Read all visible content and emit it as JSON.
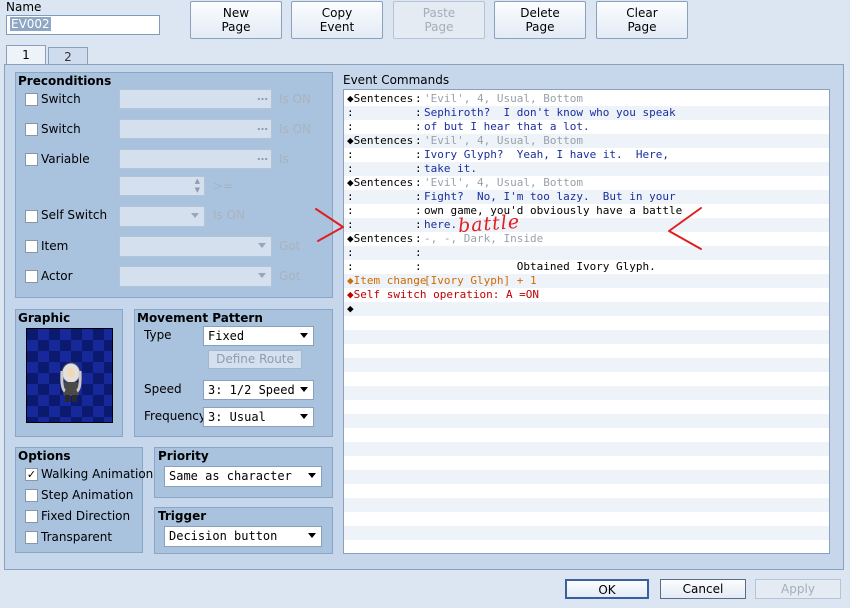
{
  "name_field": {
    "label": "Name",
    "value": "EV002"
  },
  "toolbar": {
    "new_page": [
      "New",
      "Page"
    ],
    "copy_event": [
      "Copy",
      "Event"
    ],
    "paste_page": [
      "Paste",
      "Page"
    ],
    "delete_page": [
      "Delete",
      "Page"
    ],
    "clear_page": [
      "Clear",
      "Page"
    ]
  },
  "tabs": [
    {
      "label": "1",
      "active": true
    },
    {
      "label": "2",
      "active": false
    }
  ],
  "preconditions": {
    "title": "Preconditions",
    "switch1": {
      "label": "Switch",
      "suffix": "Is ON"
    },
    "switch2": {
      "label": "Switch",
      "suffix": "Is ON"
    },
    "variable": {
      "label": "Variable",
      "suffix": "Is",
      "compare": ">="
    },
    "self_switch": {
      "label": "Self Switch",
      "suffix": "Is ON"
    },
    "item": {
      "label": "Item",
      "suffix": "Got"
    },
    "actor": {
      "label": "Actor",
      "suffix": "Got"
    }
  },
  "graphic": {
    "title": "Graphic"
  },
  "movement": {
    "title": "Movement Pattern",
    "type_label": "Type",
    "type_value": "Fixed",
    "define_route": "Define Route",
    "speed_label": "Speed",
    "speed_value": "3: 1/2 Speed",
    "frequency_label": "Frequency",
    "frequency_value": "3: Usual"
  },
  "options": {
    "title": "Options",
    "walking": "Walking Animation",
    "step": "Step Animation",
    "fixed": "Fixed Direction",
    "transparent": "Transparent"
  },
  "priority": {
    "title": "Priority",
    "value": "Same as character"
  },
  "trigger": {
    "title": "Trigger",
    "value": "Decision button"
  },
  "event_commands": {
    "title": "Event Commands",
    "rows": [
      {
        "c1": "◆Sentences",
        "c2": ":",
        "c3": "'Evil', 4, Usual, Bottom",
        "color": "gray"
      },
      {
        "c1": ":",
        "c2": ":",
        "c3": "Sephiroth?  I don't know who you speak",
        "color": "blue"
      },
      {
        "c1": ":",
        "c2": ":",
        "c3": "of but I hear that a lot.",
        "color": "blue"
      },
      {
        "c1": "◆Sentences",
        "c2": ":",
        "c3": "'Evil', 4, Usual, Bottom",
        "color": "gray"
      },
      {
        "c1": ":",
        "c2": ":",
        "c3": "Ivory Glyph?  Yeah, I have it.  Here,",
        "color": "blue"
      },
      {
        "c1": ":",
        "c2": ":",
        "c3": "take it.",
        "color": "blue"
      },
      {
        "c1": "◆Sentences",
        "c2": ":",
        "c3": "'Evil', 4, Usual, Bottom",
        "color": "gray"
      },
      {
        "c1": ":",
        "c2": ":",
        "c3": "Fight?  No, I'm too lazy.  But in your",
        "color": "blue"
      },
      {
        "c1": ":",
        "c2": ":",
        "c3": "own game, you'd obviously have a battle",
        "color": "black"
      },
      {
        "c1": ":",
        "c2": ":",
        "c3": "here.",
        "color": "blue"
      },
      {
        "c1": "◆Sentences",
        "c2": ":",
        "c3": "-, -, Dark, Inside",
        "color": "gray"
      },
      {
        "c1": ":",
        "c2": ":",
        "c3": "",
        "color": "black"
      },
      {
        "c1": ":",
        "c2": ":",
        "c3": "              Obtained Ivory Glyph.",
        "color": "black"
      },
      {
        "c1": "◆Item change",
        "c2": ":",
        "c3": "[Ivory Glyph] + 1",
        "color": "orange"
      },
      {
        "c1": "◆Self switch operation: A =ON",
        "c2": "",
        "c3": "",
        "color": "red"
      },
      {
        "c1": "◆",
        "c2": "",
        "c3": "",
        "color": "black"
      }
    ],
    "annotation": "battle"
  },
  "dialog_buttons": {
    "ok": "OK",
    "cancel": "Cancel",
    "apply": "Apply"
  }
}
